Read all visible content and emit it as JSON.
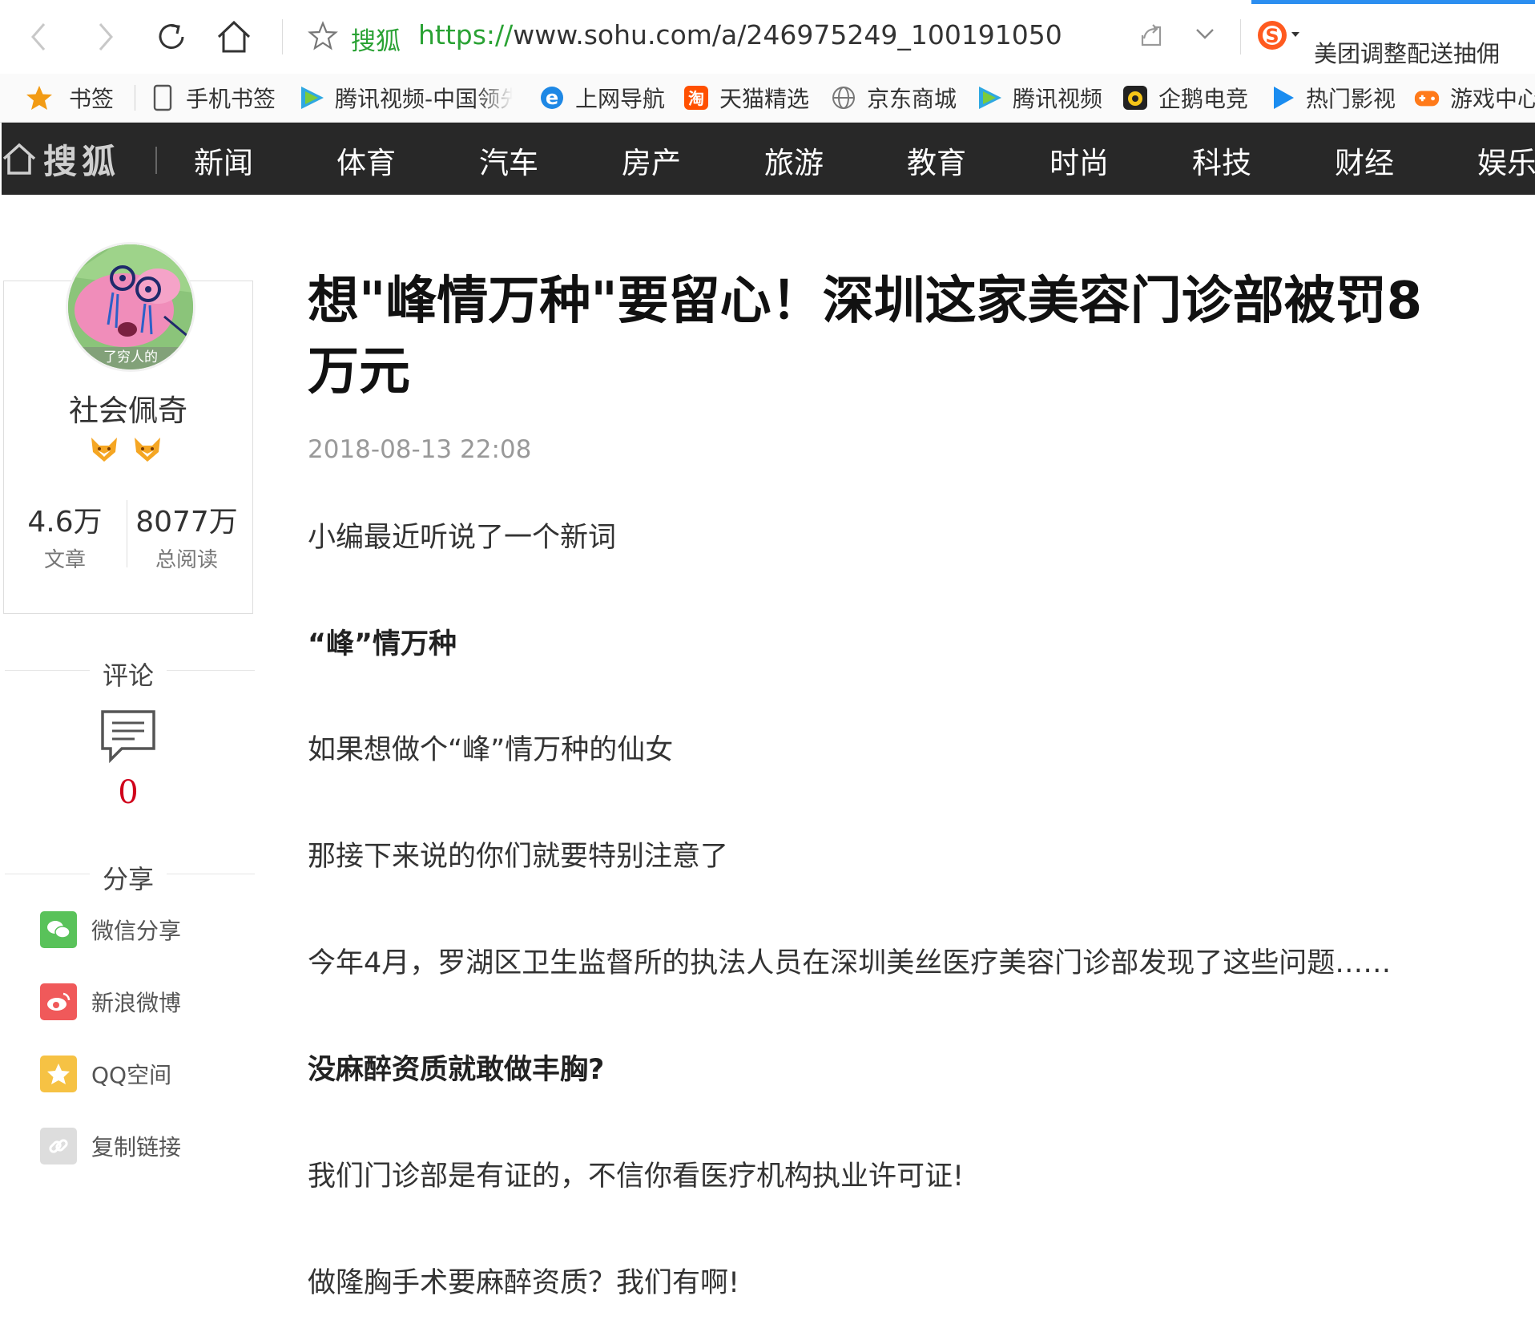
{
  "browser": {
    "site_label": "搜狐",
    "url_protocol": "https://",
    "url_rest": "www.sohu.com/a/246975249_100191050",
    "promo_text": "美团调整配送抽佣"
  },
  "bookmarks": [
    {
      "label": "书签",
      "icon": "star-icon"
    },
    {
      "label": "手机书签",
      "icon": "phone-icon"
    },
    {
      "label": "腾讯视频-中国领先",
      "icon": "tencent-video-icon"
    },
    {
      "label": "上网导航",
      "icon": "ie-icon"
    },
    {
      "label": "天猫精选",
      "icon": "taobao-icon"
    },
    {
      "label": "京东商城",
      "icon": "globe-icon"
    },
    {
      "label": "腾讯视频",
      "icon": "tencent-video-icon"
    },
    {
      "label": "企鹅电竞",
      "icon": "penguin-esports-icon"
    },
    {
      "label": "热门影视",
      "icon": "play-icon"
    },
    {
      "label": "游戏中心",
      "icon": "gamepad-icon"
    }
  ],
  "site_nav": {
    "logo_text": "搜狐",
    "items": [
      "新闻",
      "体育",
      "汽车",
      "房产",
      "旅游",
      "教育",
      "时尚",
      "科技",
      "财经",
      "娱乐"
    ]
  },
  "author": {
    "avatar_caption": "了穷人的",
    "name": "社会佩奇",
    "articles_count": "4.6万",
    "articles_label": "文章",
    "reads_count": "8077万",
    "reads_label": "总阅读"
  },
  "comments": {
    "title": "评论",
    "count": "0"
  },
  "share": {
    "title": "分享",
    "items": [
      {
        "label": "微信分享",
        "color": "#59c25a"
      },
      {
        "label": "新浪微博",
        "color": "#f0595a"
      },
      {
        "label": "QQ空间",
        "color": "#f6c244"
      },
      {
        "label": "复制链接",
        "color": "#dddddd"
      }
    ]
  },
  "article": {
    "title": "想\"峰情万种\"要留心！深圳这家美容门诊部被罚8万元",
    "date": "2018-08-13 22:08",
    "paragraphs": [
      {
        "text": "小编最近听说了一个新词",
        "bold": false
      },
      {
        "text": "“峰”情万种",
        "bold": true
      },
      {
        "text": "如果想做个“峰”情万种的仙女",
        "bold": false
      },
      {
        "text": "那接下来说的你们就要特别注意了",
        "bold": false
      },
      {
        "text": "今年4月，罗湖区卫生监督所的执法人员在深圳美丝医疗美容门诊部发现了这些问题……",
        "bold": false
      },
      {
        "text": "没麻醉资质就敢做丰胸?",
        "bold": true
      },
      {
        "text": "我们门诊部是有证的，不信你看医疗机构执业许可证!",
        "bold": false
      },
      {
        "text": "做隆胸手术要麻醉资质？我们有啊!",
        "bold": false
      }
    ]
  }
}
